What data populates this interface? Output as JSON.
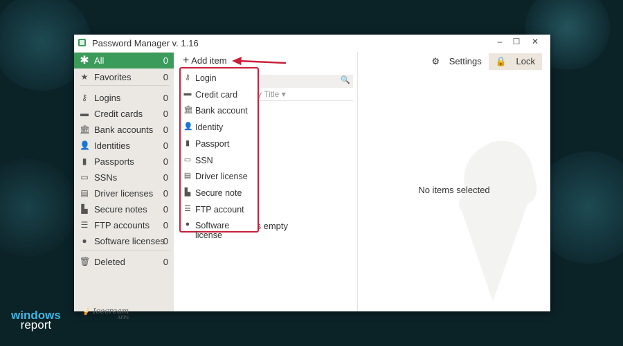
{
  "window": {
    "title": "Password Manager v. 1.16",
    "minimize": "–",
    "maximize": "☐",
    "close": "✕"
  },
  "sidebar": {
    "items": [
      {
        "label": "All",
        "count": "0",
        "icon": "asterisk-icon",
        "glyph": "✱"
      },
      {
        "label": "Favorites",
        "count": "0",
        "icon": "star-icon",
        "glyph": "★"
      },
      {
        "label": "Logins",
        "count": "0",
        "icon": "key-icon",
        "glyph": "⚷"
      },
      {
        "label": "Credit cards",
        "count": "0",
        "icon": "credit-card-icon",
        "glyph": "▬"
      },
      {
        "label": "Bank accounts",
        "count": "0",
        "icon": "bank-icon",
        "glyph": "🏛"
      },
      {
        "label": "Identities",
        "count": "0",
        "icon": "person-icon",
        "glyph": "👤"
      },
      {
        "label": "Passports",
        "count": "0",
        "icon": "passport-icon",
        "glyph": "▮"
      },
      {
        "label": "SSNs",
        "count": "0",
        "icon": "ssn-icon",
        "glyph": "▭"
      },
      {
        "label": "Driver licenses",
        "count": "0",
        "icon": "id-card-icon",
        "glyph": "▤"
      },
      {
        "label": "Secure notes",
        "count": "0",
        "icon": "note-icon",
        "glyph": "▙"
      },
      {
        "label": "FTP accounts",
        "count": "0",
        "icon": "database-icon",
        "glyph": "☰"
      },
      {
        "label": "Software licenses",
        "count": "0",
        "icon": "disc-icon",
        "glyph": "●"
      },
      {
        "label": "Deleted",
        "count": "0",
        "icon": "trash-icon",
        "glyph": "🗑"
      }
    ],
    "logo": "Icecream",
    "logo_sub": "APPS"
  },
  "toolbar": {
    "add_item": "Add item",
    "settings": "Settings",
    "lock": "Lock"
  },
  "list": {
    "sort": "Sort by Title ▾",
    "empty": "Directory is empty"
  },
  "details": {
    "empty": "No items selected"
  },
  "add_menu": [
    {
      "label": "Login",
      "glyph": "⚷"
    },
    {
      "label": "Credit card",
      "glyph": "▬"
    },
    {
      "label": "Bank account",
      "glyph": "🏛"
    },
    {
      "label": "Identity",
      "glyph": "👤"
    },
    {
      "label": "Passport",
      "glyph": "▮"
    },
    {
      "label": "SSN",
      "glyph": "▭"
    },
    {
      "label": "Driver license",
      "glyph": "▤"
    },
    {
      "label": "Secure note",
      "glyph": "▙"
    },
    {
      "label": "FTP account",
      "glyph": "☰"
    },
    {
      "label": "Software license",
      "glyph": "●"
    }
  ],
  "watermark": {
    "line1": "windows",
    "line2": "report"
  },
  "colors": {
    "accent": "#3b9b5a",
    "highlight": "#c8203a"
  }
}
